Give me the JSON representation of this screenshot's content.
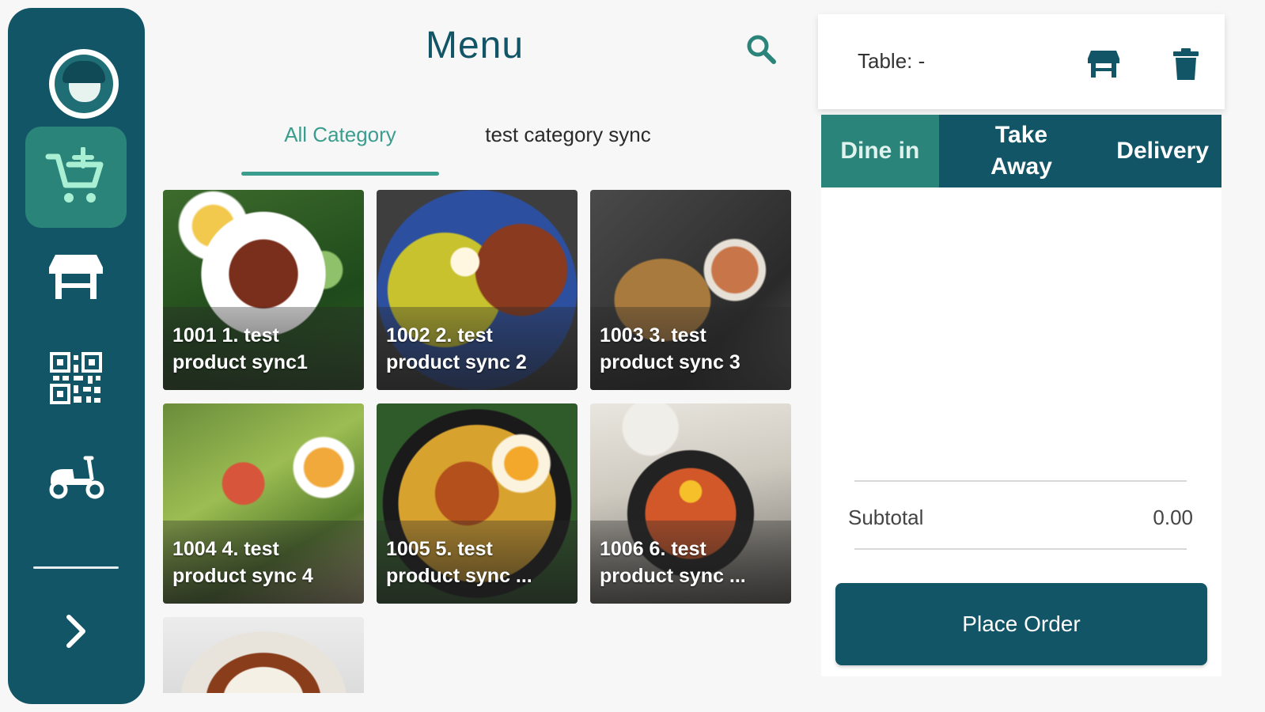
{
  "sidebar": {
    "items": [
      {
        "name": "add-to-cart",
        "icon": "cart-plus-icon",
        "active": true
      },
      {
        "name": "tables",
        "icon": "table-icon",
        "active": false
      },
      {
        "name": "qr-code",
        "icon": "qr-code-icon",
        "active": false
      },
      {
        "name": "delivery",
        "icon": "scooter-icon",
        "active": false
      }
    ],
    "expand_icon": "chevron-right-icon"
  },
  "menu": {
    "title": "Menu",
    "search_icon": "search-icon",
    "tabs": [
      {
        "label": "All Category",
        "active": true
      },
      {
        "label": "test category sync",
        "active": false
      }
    ],
    "products": [
      {
        "line1": "1001 1. test",
        "line2": "product sync1"
      },
      {
        "line1": "1002 2. test",
        "line2": "product sync 2"
      },
      {
        "line1": "1003 3. test",
        "line2": "product sync 3"
      },
      {
        "line1": "1004 4. test",
        "line2": "product sync 4"
      },
      {
        "line1": "1005 5. test",
        "line2": "product sync ..."
      },
      {
        "line1": "1006 6. test",
        "line2": "product sync ..."
      }
    ]
  },
  "order": {
    "table_label": "Table: -",
    "order_types": [
      {
        "label": "Dine in",
        "active": true
      },
      {
        "label": "Take Away",
        "active": false
      },
      {
        "label": "Delivery",
        "active": false
      }
    ],
    "subtotal_label": "Subtotal",
    "subtotal_value": "0.00",
    "place_order_label": "Place Order"
  },
  "colors": {
    "primary": "#125566",
    "accent": "#2b8479",
    "tab_active": "#3b9d8d"
  }
}
